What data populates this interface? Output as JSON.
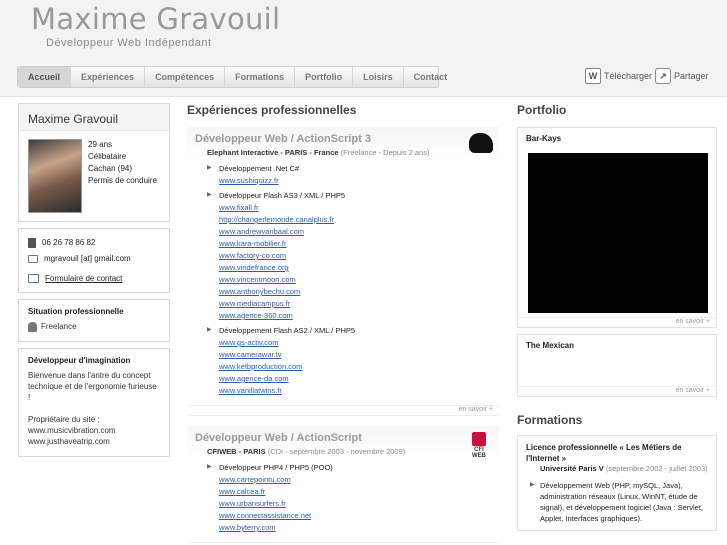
{
  "header": {
    "title": "Maxime Gravouil",
    "subtitle": "Développeur Web Indépendant"
  },
  "nav": [
    "Accueil",
    "Expériences",
    "Compétences",
    "Formations",
    "Portfolio",
    "Loisirs",
    "Contact"
  ],
  "tools": {
    "download_label": "Télécharger",
    "download_icon": "W",
    "share_label": "Partager"
  },
  "profile": {
    "name": "Maxime Gravouil",
    "age": "29 ans",
    "status": "Célibataire",
    "city": "Cachan (94)",
    "licence": "Permis de conduire"
  },
  "contact": {
    "phone": "06 26 78 86 82",
    "email": "mgravouil [at] gmail.com",
    "form_link": "Formulaire de contact"
  },
  "situation": {
    "title": "Situation professionnelle",
    "value": "Freelance"
  },
  "imagination": {
    "title": "Développeur d'imagination",
    "text": "Bienvenue dans l'antre du concept technique et de l'ergonomie furieuse !",
    "owner_intro": "Propriétaire du site :",
    "sites": [
      "www.musicvibration.com",
      "www.justhaveatrip.com"
    ]
  },
  "experiences": {
    "heading": "Expériences professionnelles",
    "items": [
      {
        "title": "Développeur Web / ActionScript 3",
        "company": "Elephant Interactive - PARIS - France",
        "period": "(Freelance - Depuis 2 ans)",
        "groups": [
          {
            "label": "Développement .Net C#",
            "links": [
              "www.sushiquizz.fr"
            ]
          },
          {
            "label": "Développeur Flash AS3 / XML / PHP5",
            "links": [
              "www.fixall.fr",
              "http://changerlemonde.canalplus.fr",
              "www.andrewvanbaal.com",
              "www.kara-mobilier.fr",
              "www.factory-co.com",
              "www.vindefrance.org",
              "www.vincentmoon.com",
              "www.anthonybechu.com",
              "www.mediacampus.fr",
              "www.agence-360.com"
            ]
          },
          {
            "label": "Développement Flash AS2 / XML / PHP5",
            "links": [
              "www.gs-activ.com",
              "www.camerawar.tv",
              "www.ketbproduction.com",
              "www.agence-da.com",
              "www.vanillatwins.fr"
            ]
          }
        ],
        "more": "en savoir +"
      },
      {
        "title": "Développeur Web / ActionScript",
        "company": "CFIWEB - PARIS",
        "period": "(CDI - septembre 2003 - novembre 2009)",
        "logo_text": "CFI WEB",
        "groups": [
          {
            "label": "Développeur PHP4 / PHP5 (POO)",
            "links": [
              "www.carrepointu.com",
              "www.calcea.fr",
              "www.urbansurfers.fr",
              "www.connectassistance.net",
              "www.byterry.com"
            ]
          }
        ]
      }
    ]
  },
  "portfolio": {
    "heading": "Portfolio",
    "items": [
      {
        "title": "Bar-Kays",
        "more": "en savoir +"
      },
      {
        "title": "The Mexican",
        "more": "en savoir +"
      }
    ]
  },
  "formations": {
    "heading": "Formations",
    "title": "Licence professionnelle « Les Métiers de l'Internet »",
    "school": "Université Paris V",
    "period": "(septembre 2002 - juillet 2003)",
    "detail": "Développement Web (PHP, mySQL, Java), administration réseaux (Linux, WinNT, étude de signal), et développement logiciel (Java : Servlet, Applet, Interfaces graphiques)."
  }
}
